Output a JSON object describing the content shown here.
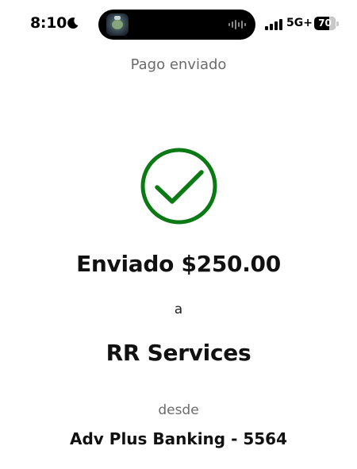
{
  "status_bar": {
    "time": "8:10",
    "network": "5G+",
    "battery_level": "70",
    "battery_fraction": 0.7,
    "icons": {
      "moon": "moon-icon",
      "signal": "signal-bars-icon",
      "waveform": "audio-waveform-icon",
      "app": "app-activity-icon"
    }
  },
  "header": {
    "title": "Pago enviado"
  },
  "confirmation": {
    "icon": "checkmark-circle-icon",
    "accent_color": "#0c7a14",
    "amount_text": "Enviado $250.00",
    "to_text": "a",
    "recipient": "RR Services",
    "from_label": "desde",
    "account": "Adv Plus Banking - 5564"
  }
}
